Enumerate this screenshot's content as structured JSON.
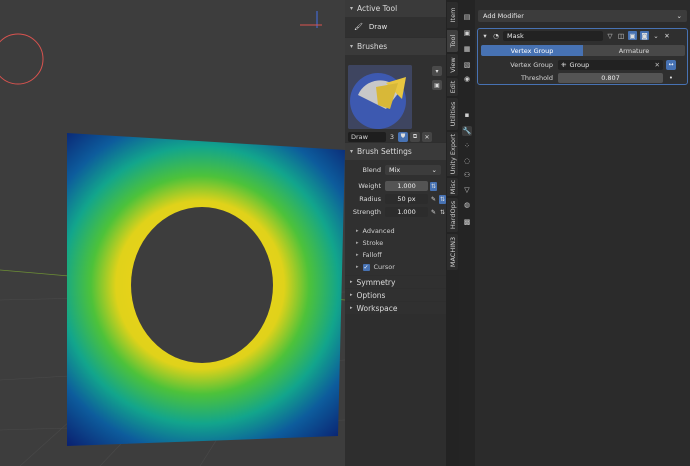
{
  "active_tool": {
    "header": "Active Tool",
    "tool_name": "Draw"
  },
  "brushes": {
    "header": "Brushes",
    "name": "Draw",
    "users": "3"
  },
  "brush_settings": {
    "header": "Brush Settings",
    "blend_label": "Blend",
    "blend_value": "Mix",
    "weight_label": "Weight",
    "weight_value": "1.000",
    "radius_label": "Radius",
    "radius_value": "50 px",
    "strength_label": "Strength",
    "strength_value": "1.000",
    "subpanels": [
      "Advanced",
      "Stroke",
      "Falloff",
      "Cursor"
    ]
  },
  "collapsed_panels": [
    "Symmetry",
    "Options",
    "Workspace"
  ],
  "sidebar_tabs": [
    "Item",
    "Tool",
    "View",
    "Edit",
    "Utilities",
    "Unity Export",
    "Misc",
    "HardOps",
    "MACHIN3"
  ],
  "properties": {
    "add_modifier": "Add Modifier",
    "modifier": {
      "name": "Mask",
      "mode_vertex_group": "Vertex Group",
      "mode_armature": "Armature",
      "vertex_group_label": "Vertex Group",
      "vertex_group_value": "Group",
      "threshold_label": "Threshold",
      "threshold_value": "0.807"
    }
  },
  "colors": {
    "accent": "#4772b3",
    "highlight_blue": "#3d8fb3",
    "panel_bg": "#303030"
  }
}
